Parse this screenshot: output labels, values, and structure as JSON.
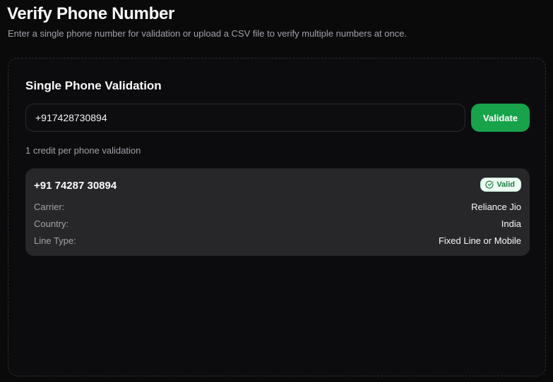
{
  "header": {
    "title": "Verify Phone Number",
    "subtitle": "Enter a single phone number for validation or upload a CSV file to verify multiple numbers at once."
  },
  "single_validation": {
    "title": "Single Phone Validation",
    "input_value": "+917428730894",
    "validate_label": "Validate",
    "credit_note": "1 credit per phone validation"
  },
  "result": {
    "phone": "+91 74287 30894",
    "status": "Valid",
    "status_icon": "check-circle-icon",
    "status_color": "#15803d",
    "details": [
      {
        "label": "Carrier:",
        "value": "Reliance Jio"
      },
      {
        "label": "Country:",
        "value": "India"
      },
      {
        "label": "Line Type:",
        "value": "Fixed Line or Mobile"
      }
    ]
  },
  "colors": {
    "background": "#0a0a0b",
    "accent": "#16a34a",
    "card": "#27272a"
  }
}
